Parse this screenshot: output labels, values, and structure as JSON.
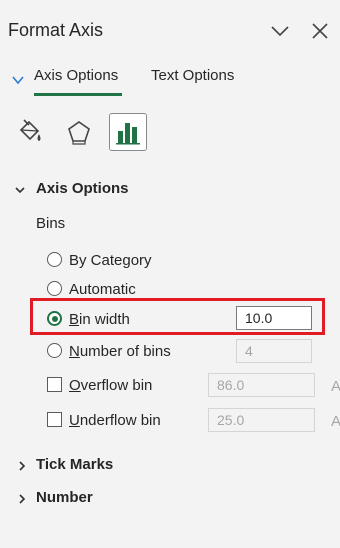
{
  "pane": {
    "title": "Format Axis",
    "collapse_icon": "chevron-down-icon",
    "close_icon": "close-icon"
  },
  "tabs": [
    {
      "label": "Axis Options",
      "active": true
    },
    {
      "label": "Text Options",
      "active": false
    }
  ],
  "category_icons": [
    "fill-line-icon",
    "effects-pentagon-icon",
    "axis-options-bar-chart-icon"
  ],
  "axis_options": {
    "section_label": "Axis Options",
    "bins_label": "Bins",
    "options": [
      {
        "label": "By Category",
        "selected": false
      },
      {
        "label": "Automatic",
        "selected": false
      },
      {
        "label_pre": "",
        "label_u": "B",
        "label_post": "in width",
        "selected": true,
        "value": "10.0"
      },
      {
        "label_pre": "",
        "label_u": "N",
        "label_post": "umber of bins",
        "selected": false,
        "value": "4"
      }
    ],
    "overflow": {
      "label_pre": "O",
      "label_post": "verflow bin",
      "checked": false,
      "value": "86.0",
      "suffix": "A"
    },
    "underflow": {
      "label_pre": "U",
      "label_post": "nderflow bin",
      "checked": false,
      "value": "25.0",
      "suffix": "A"
    }
  },
  "sections": [
    {
      "label": "Tick Marks"
    },
    {
      "label": "Number"
    }
  ],
  "colors": {
    "accent": "#217346",
    "highlight": "#e01b24",
    "background": "#f3f3f3"
  }
}
